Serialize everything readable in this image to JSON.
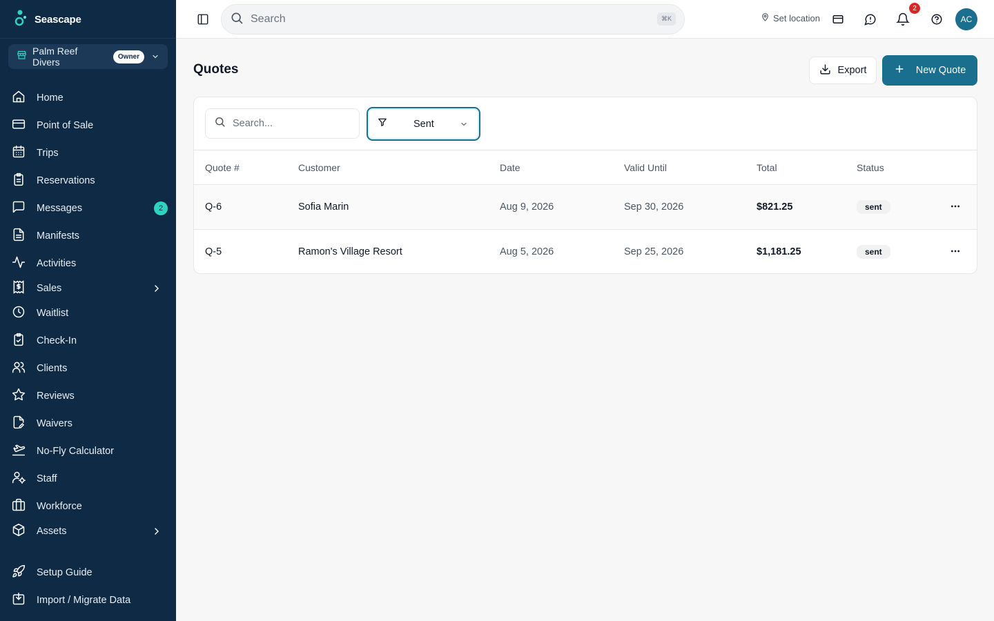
{
  "brand": {
    "name": "Seascape"
  },
  "org": {
    "name": "Palm Reef Divers",
    "role": "Owner"
  },
  "sidebar": {
    "items": [
      {
        "label": "Home",
        "icon": "home-icon"
      },
      {
        "label": "Point of Sale",
        "icon": "credit-card-icon"
      },
      {
        "label": "Trips",
        "icon": "calendar-icon"
      },
      {
        "label": "Reservations",
        "icon": "clipboard-icon"
      },
      {
        "label": "Messages",
        "icon": "message-square-icon",
        "badge": "2"
      },
      {
        "label": "Manifests",
        "icon": "file-text-icon"
      },
      {
        "label": "Activities",
        "icon": "activity-icon"
      },
      {
        "label": "Sales",
        "icon": "receipt-dollar-icon"
      },
      {
        "label": "Waitlist",
        "icon": "clock-icon"
      },
      {
        "label": "Check-In",
        "icon": "clipboard-check-icon"
      },
      {
        "label": "Clients",
        "icon": "users-icon"
      },
      {
        "label": "Reviews",
        "icon": "star-icon"
      },
      {
        "label": "Waivers",
        "icon": "file-signature-icon"
      },
      {
        "label": "No-Fly Calculator",
        "icon": "plane-landing-icon"
      },
      {
        "label": "Staff",
        "icon": "user-cog-icon"
      },
      {
        "label": "Workforce",
        "icon": "briefcase-icon"
      },
      {
        "label": "Assets",
        "icon": "box-icon"
      },
      {
        "label": "Setup Guide",
        "icon": "rocket-icon"
      },
      {
        "label": "Import / Migrate Data",
        "icon": "import-icon"
      }
    ]
  },
  "topbar": {
    "search_placeholder": "Search",
    "shortcut": "⌘K",
    "set_location": "Set location",
    "notification_count": "2",
    "avatar_initials": "AC"
  },
  "page": {
    "title": "Quotes",
    "export_label": "Export",
    "new_label": "New Quote"
  },
  "table": {
    "search_placeholder": "Search...",
    "filter_value": "Sent",
    "columns": [
      "Quote #",
      "Customer",
      "Date",
      "Valid Until",
      "Total",
      "Status"
    ],
    "rows": [
      {
        "quote": "Q-6",
        "customer": "Sofia Marin",
        "date": "Aug 9, 2026",
        "valid_until": "Sep 30, 2026",
        "total": "$821.25",
        "status": "sent"
      },
      {
        "quote": "Q-5",
        "customer": "Ramon's Village Resort",
        "date": "Aug 5, 2026",
        "valid_until": "Sep 25, 2026",
        "total": "$1,181.25",
        "status": "sent"
      }
    ]
  },
  "colors": {
    "sidebar_bg": "#0f2a44",
    "accent": "#1a6e8e",
    "badge_teal": "#2dd4bf",
    "notification_red": "#dc2626"
  }
}
